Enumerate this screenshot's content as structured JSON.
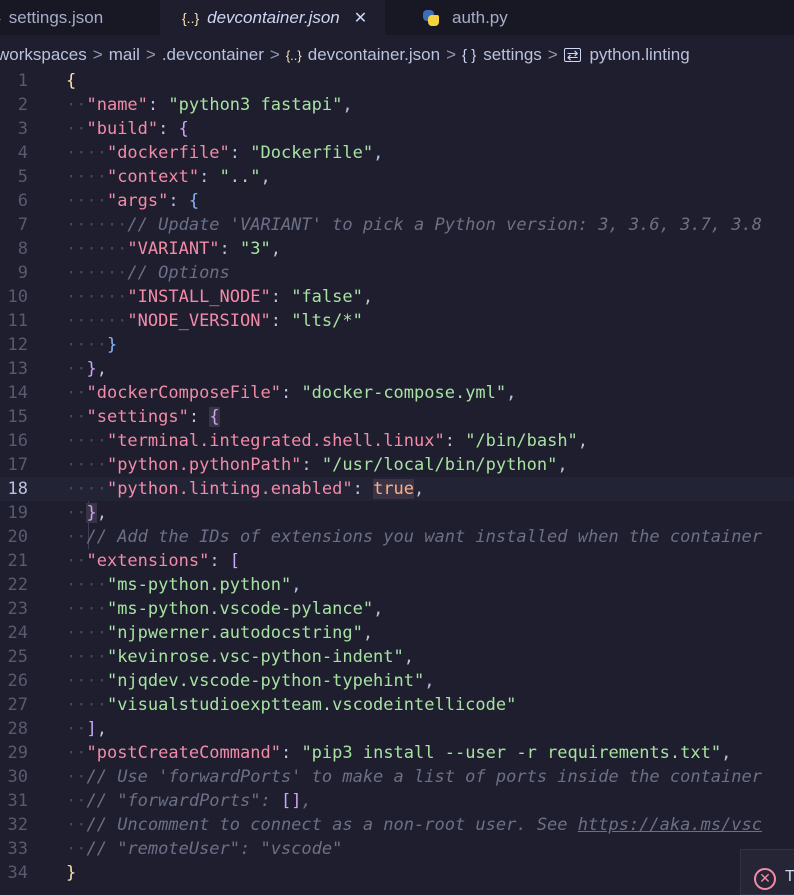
{
  "tabs": [
    {
      "label": "settings.json",
      "icon": "json-braces-icon",
      "icon_glyph": "}",
      "active": false
    },
    {
      "label": "devcontainer.json",
      "icon": "json-braces-icon",
      "icon_glyph": "{..}",
      "active": true,
      "close_glyph": "✕"
    },
    {
      "label": "auth.py",
      "icon": "python-icon",
      "active": false
    }
  ],
  "breadcrumb": {
    "items": [
      "workspaces",
      "mail",
      ".devcontainer",
      "devcontainer.json",
      "settings",
      "python.linting"
    ],
    "separator": ">",
    "file_icon_glyph": "{..}",
    "object_icon_glyph": "{ }",
    "property_icon_glyph": "⇄"
  },
  "editor": {
    "current_line": 18,
    "line_numbers": [
      "1",
      "2",
      "3",
      "4",
      "5",
      "6",
      "7",
      "8",
      "9",
      "10",
      "11",
      "12",
      "13",
      "14",
      "15",
      "16",
      "17",
      "18",
      "19",
      "20",
      "21",
      "22",
      "23",
      "24",
      "25",
      "26",
      "27",
      "28",
      "29",
      "30",
      "31",
      "32",
      "33",
      "34"
    ],
    "tokens": {
      "l1_open": "{",
      "l2_key": "\"name\"",
      "l2_val": "\"python3 fastapi\"",
      "l3_key": "\"build\"",
      "l3_open": "{",
      "l4_key": "\"dockerfile\"",
      "l4_val": "\"Dockerfile\"",
      "l5_key": "\"context\"",
      "l5_val": "\"..\"",
      "l6_key": "\"args\"",
      "l6_open": "{",
      "l7_comment": "// Update 'VARIANT' to pick a Python version: 3, 3.6, 3.7, 3.8",
      "l8_key": "\"VARIANT\"",
      "l8_val": "\"3\"",
      "l9_comment": "// Options",
      "l10_key": "\"INSTALL_NODE\"",
      "l10_val": "\"false\"",
      "l11_key": "\"NODE_VERSION\"",
      "l11_val": "\"lts/*\"",
      "l12_close": "}",
      "l13_close": "}",
      "l14_key": "\"dockerComposeFile\"",
      "l14_val": "\"docker-compose.yml\"",
      "l15_key": "\"settings\"",
      "l15_open": "{",
      "l16_key": "\"terminal.integrated.shell.linux\"",
      "l16_val": "\"/bin/bash\"",
      "l17_key": "\"python.pythonPath\"",
      "l17_val": "\"/usr/local/bin/python\"",
      "l18_key": "\"python.linting.enabled\"",
      "l18_val": "true",
      "l19_close": "}",
      "l20_comment": "// Add the IDs of extensions you want installed when the container",
      "l21_key": "\"extensions\"",
      "l21_open": "[",
      "l22_val": "\"ms-python.python\"",
      "l23_val": "\"ms-python.vscode-pylance\"",
      "l24_val": "\"njpwerner.autodocstring\"",
      "l25_val": "\"kevinrose.vsc-python-indent\"",
      "l26_val": "\"njqdev.vscode-python-typehint\"",
      "l27_val": "\"visualstudioexptteam.vscodeintellicode\"",
      "l28_close": "]",
      "l29_key": "\"postCreateCommand\"",
      "l29_val": "\"pip3 install --user -r requirements.txt\"",
      "l30_comment": "// Use 'forwardPorts' to make a list of ports inside the container",
      "l31_comment": "// \"forwardPorts\": ",
      "l31_arr": "[]",
      "l32_comment": "// Uncomment to connect as a non-root user. See ",
      "l32_link": "https://aka.ms/vsc",
      "l33_comment": "// \"remoteUser\": \"vscode\"",
      "l34_close": "}"
    }
  },
  "notification": {
    "icon": "error-icon",
    "icon_glyph": "✕",
    "text": "T"
  },
  "colors": {
    "background": "#1e1e2e",
    "key": "#f38ba8",
    "string": "#a6e3a1",
    "comment": "#6c7086",
    "brace1": "#f9e2af",
    "brace2": "#cba6f7",
    "brace3": "#89b4fa",
    "constant": "#fab387"
  }
}
